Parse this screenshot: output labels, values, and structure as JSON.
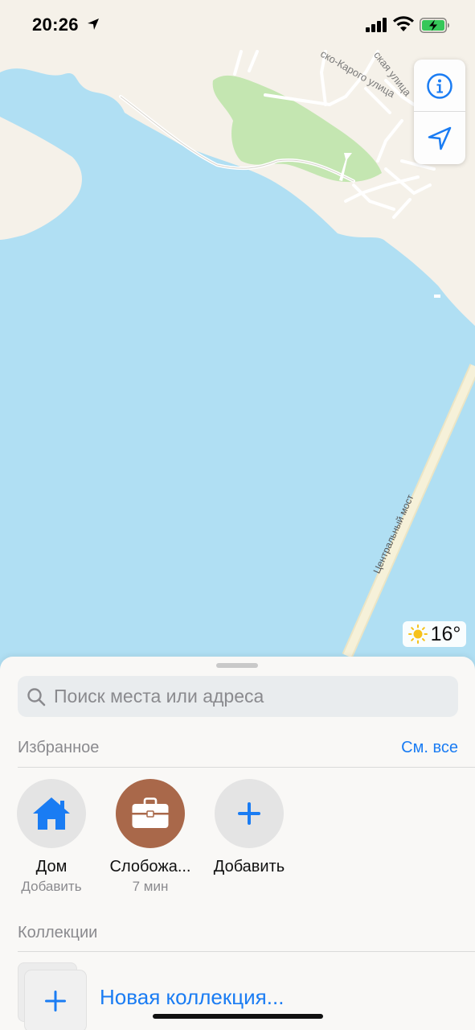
{
  "status_bar": {
    "time": "20:26",
    "icons": [
      "location-arrow-icon",
      "cellular-signal-icon",
      "wifi-icon",
      "battery-charging-icon"
    ],
    "battery_color": "#35c759"
  },
  "map": {
    "streets": [
      "ско-Карого улица",
      "ская улица"
    ],
    "bridge": "Центральный мост",
    "water_color": "#b0dff3",
    "land_color": "#f5f1e9",
    "park_color": "#c4e6b1"
  },
  "map_controls": {
    "info_icon": "info-icon",
    "location_icon": "location-arrow-icon",
    "accent": "#1a7cf3"
  },
  "weather": {
    "icon": "sun-icon",
    "temperature": "16°"
  },
  "search": {
    "placeholder": "Поиск места или адреса",
    "value": ""
  },
  "favorites": {
    "title": "Избранное",
    "see_all": "См. все",
    "items": [
      {
        "title": "Дом",
        "subtitle": "Добавить",
        "icon": "home-icon",
        "bg": "#e4e4e4"
      },
      {
        "title": "Слобожа...",
        "subtitle": "7 мин",
        "icon": "briefcase-icon",
        "bg": "#a9684a"
      },
      {
        "title": "Добавить",
        "subtitle": "",
        "icon": "plus-icon",
        "bg": "#e4e4e4"
      }
    ]
  },
  "collections": {
    "title": "Коллекции",
    "new_label": "Новая коллекция..."
  }
}
